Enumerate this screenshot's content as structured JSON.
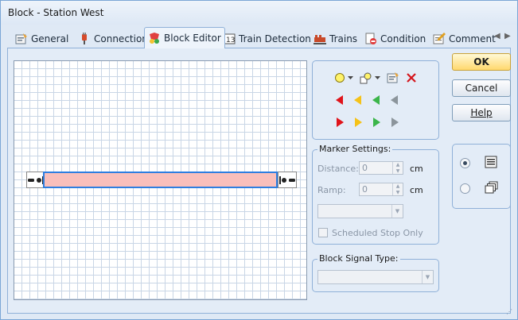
{
  "window": {
    "title": "Block - Station West"
  },
  "tabs": [
    {
      "label": "General",
      "icon": "general-icon"
    },
    {
      "label": "Connection",
      "icon": "connection-icon"
    },
    {
      "label": "Block Editor",
      "icon": "block-editor-icon",
      "active": true
    },
    {
      "label": "Train Detection",
      "icon": "train-detection-icon"
    },
    {
      "label": "Trains",
      "icon": "trains-icon"
    },
    {
      "label": "Condition",
      "icon": "condition-icon"
    },
    {
      "label": "Comment",
      "icon": "comment-icon"
    }
  ],
  "marker_settings": {
    "title": "Marker Settings:",
    "distance_label": "Distance:",
    "distance_value": "0",
    "ramp_label": "Ramp:",
    "ramp_value": "0",
    "unit": "cm",
    "scheduled_stop_label": "Scheduled Stop Only"
  },
  "block_signal": {
    "title": "Block Signal Type:"
  },
  "buttons": {
    "ok": "OK",
    "cancel": "Cancel",
    "help": "Help"
  },
  "colors": {
    "block_fill": "#f9bfbb",
    "block_border": "#2e7ee0",
    "marker_red": "#e0141b",
    "marker_yellow": "#f5c218",
    "marker_green": "#3bb54a",
    "marker_gray": "#8c959c"
  }
}
